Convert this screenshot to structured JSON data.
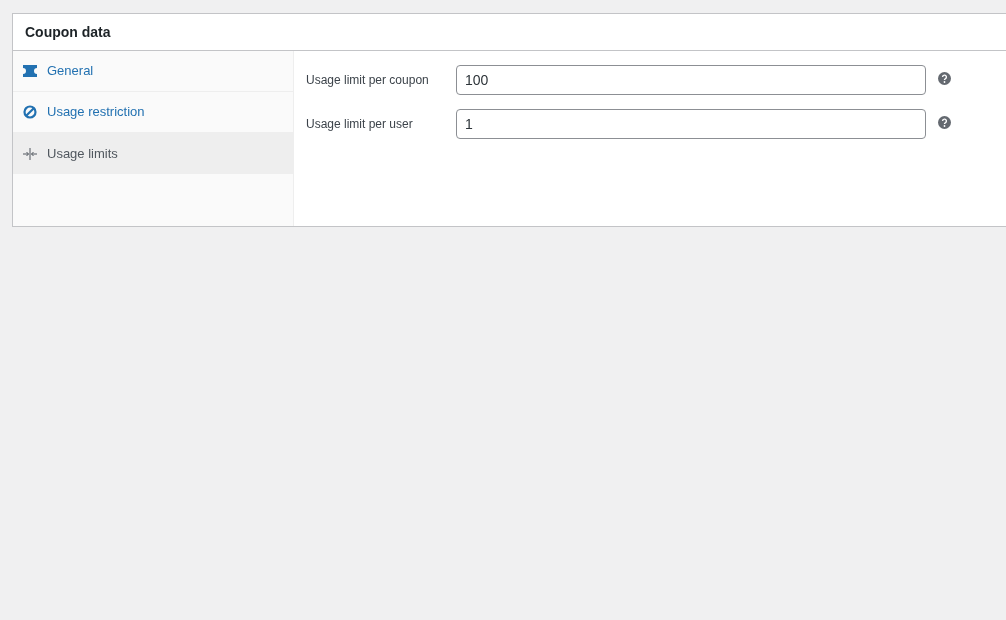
{
  "panel": {
    "title": "Coupon data"
  },
  "tabs": [
    {
      "label": "General",
      "kind": "ticket",
      "selected": false
    },
    {
      "label": "Usage restriction",
      "kind": "ban",
      "selected": false
    },
    {
      "label": "Usage limits",
      "kind": "limits",
      "selected": true
    }
  ],
  "fields": [
    {
      "label": "Usage limit per coupon",
      "value": "100"
    },
    {
      "label": "Usage limit per user",
      "value": "1"
    }
  ]
}
